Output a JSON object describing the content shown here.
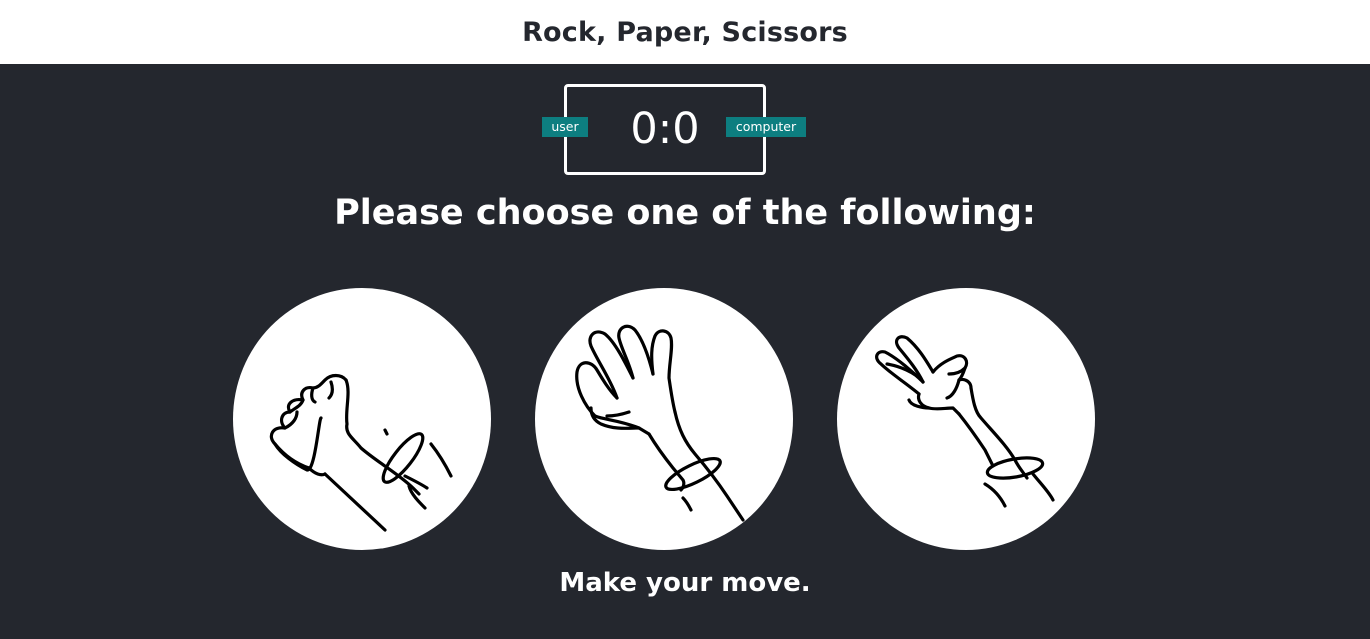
{
  "header": {
    "title": "Rock, Paper, Scissors"
  },
  "scoreboard": {
    "user_label": "user",
    "computer_label": "computer",
    "score": "0:0"
  },
  "prompt": "Please choose one of the following:",
  "choices": [
    {
      "name": "rock",
      "icon": "rock-hand-icon"
    },
    {
      "name": "paper",
      "icon": "paper-hand-icon"
    },
    {
      "name": "scissors",
      "icon": "scissors-hand-icon"
    }
  ],
  "message": "Make your move.",
  "colors": {
    "background": "#24272e",
    "header_background": "#ffffff",
    "badge": "#0d7e80",
    "text": "#ffffff"
  }
}
